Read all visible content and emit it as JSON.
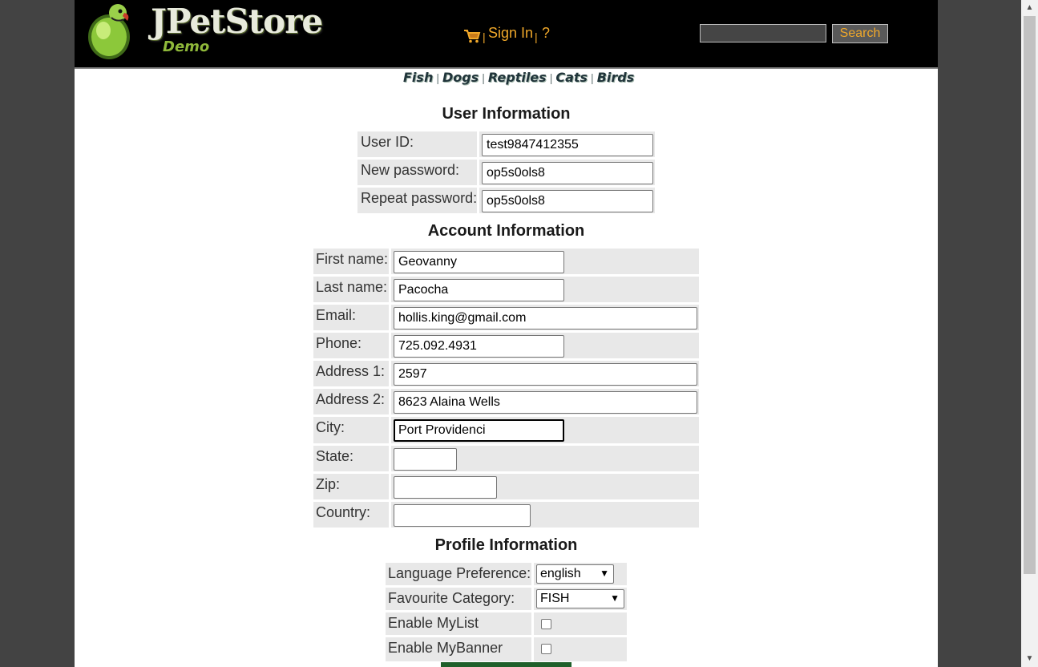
{
  "header": {
    "logo_title": "JPetStore",
    "logo_subtitle": "Demo",
    "sign_in": "Sign In",
    "help": "?",
    "separator": "|",
    "search_button": "Search",
    "search_value": ""
  },
  "categories": [
    "Fish",
    "Dogs",
    "Reptiles",
    "Cats",
    "Birds"
  ],
  "user_info": {
    "heading": "User Information",
    "fields": [
      {
        "label": "User ID:",
        "value": "test9847412355"
      },
      {
        "label": "New password:",
        "value": "op5s0ols8"
      },
      {
        "label": "Repeat password:",
        "value": "op5s0ols8"
      }
    ]
  },
  "account_info": {
    "heading": "Account Information",
    "fields": [
      {
        "label": "First name:",
        "value": "Geovanny"
      },
      {
        "label": "Last name:",
        "value": "Pacocha"
      },
      {
        "label": "Email:",
        "value": "hollis.king@gmail.com"
      },
      {
        "label": "Phone:",
        "value": "725.092.4931"
      },
      {
        "label": "Address 1:",
        "value": "2597"
      },
      {
        "label": "Address 2:",
        "value": "8623 Alaina Wells"
      },
      {
        "label": "City:",
        "value": "Port Providenci"
      },
      {
        "label": "State:",
        "value": ""
      },
      {
        "label": "Zip:",
        "value": ""
      },
      {
        "label": "Country:",
        "value": ""
      }
    ]
  },
  "profile_info": {
    "heading": "Profile Information",
    "language_label": "Language Preference:",
    "language_value": "english",
    "category_label": "Favourite Category:",
    "category_value": "FISH",
    "mylist_label": "Enable MyList",
    "mybanner_label": "Enable MyBanner"
  },
  "colors": {
    "header_bg": "#000000",
    "menu_link": "#f0a82a",
    "cell_bg": "#e8e8e8",
    "submit_bg": "#1f5f2a"
  }
}
